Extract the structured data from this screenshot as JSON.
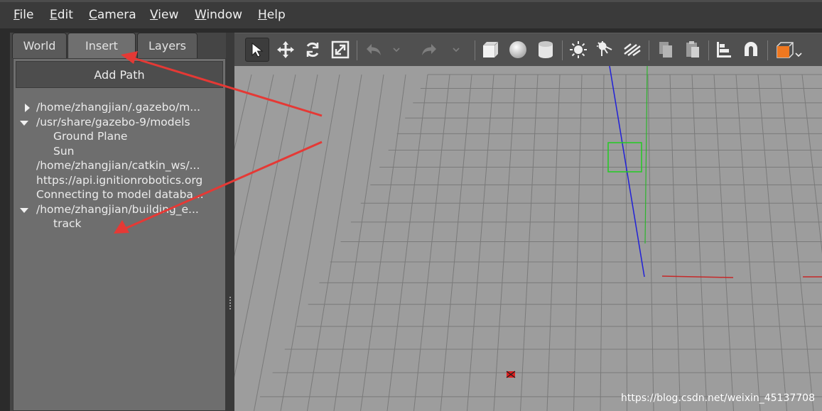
{
  "menu": {
    "file": {
      "first": "F",
      "rest": "ile"
    },
    "edit": {
      "first": "E",
      "rest": "dit"
    },
    "camera": {
      "first": "C",
      "rest": "amera"
    },
    "view": {
      "first": "V",
      "rest": "iew"
    },
    "window": {
      "first": "W",
      "rest": "indow"
    },
    "help": {
      "first": "H",
      "rest": "elp"
    }
  },
  "tabs": {
    "world": "World",
    "insert": "Insert",
    "layers": "Layers",
    "active": "Insert"
  },
  "insert_panel": {
    "add_path_label": "Add Path",
    "tree": [
      {
        "label": "/home/zhangjian/.gazebo/m...",
        "expander": "collapsed",
        "indent": 0
      },
      {
        "label": "/usr/share/gazebo-9/models",
        "expander": "expanded",
        "indent": 0
      },
      {
        "label": "Ground Plane",
        "expander": "none",
        "indent": 1
      },
      {
        "label": "Sun",
        "expander": "none",
        "indent": 1
      },
      {
        "label": "/home/zhangjian/catkin_ws/...",
        "expander": "none",
        "indent": 0
      },
      {
        "label": "https://api.ignitionrobotics.org",
        "expander": "none",
        "indent": 0
      },
      {
        "label": "Connecting to model databa...",
        "expander": "none",
        "indent": 0
      },
      {
        "label": "/home/zhangjian/building_e...",
        "expander": "expanded",
        "indent": 0
      },
      {
        "label": "track",
        "expander": "none",
        "indent": 1
      }
    ]
  },
  "toolbar": {
    "tools": [
      "select-arrow-icon",
      "translate-icon",
      "rotate-icon",
      "scale-icon",
      "undo-icon",
      "undo-dropdown-icon",
      "redo-icon",
      "redo-dropdown-icon",
      "box-icon",
      "sphere-icon",
      "cylinder-icon",
      "point-light-icon",
      "spot-light-icon",
      "directional-light-icon",
      "copy-icon",
      "paste-icon",
      "align-icon",
      "snap-icon",
      "view-angle-icon"
    ],
    "selected": "select-arrow-icon",
    "accent_color": "#f07820"
  },
  "viewport": {
    "background_color": "#9d9d9d",
    "grid_color": "#7a7a7a",
    "x_axis_color": "#c62828",
    "y_axis_color": "#2db52d",
    "z_axis_color": "#2020d8"
  },
  "annotation_color": "#e53935",
  "watermark": "https://blog.csdn.net/weixin_45137708"
}
